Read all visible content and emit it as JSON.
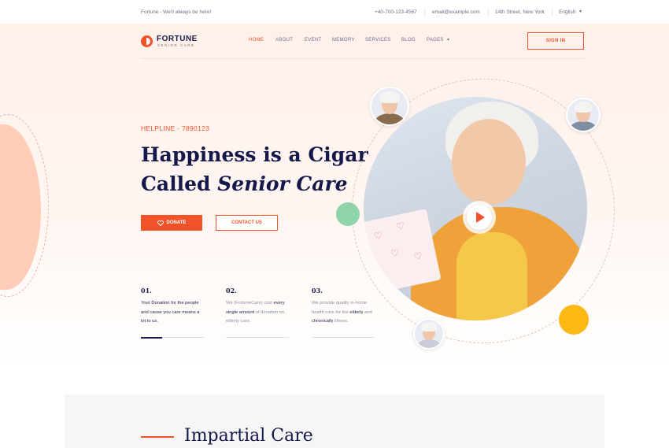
{
  "topbar": {
    "tagline": "Fortune - We'll always be here!",
    "phone": "+40-700-123-4567",
    "email": "email@example.com",
    "address": "14th Street, New York",
    "language": "English"
  },
  "brand": {
    "name": "FORTUNE",
    "subtitle": "SENIOR CARE",
    "accent": "#f0522a"
  },
  "nav": {
    "items": [
      {
        "label": "HOME",
        "active": true
      },
      {
        "label": "ABOUT"
      },
      {
        "label": "EVENT"
      },
      {
        "label": "MEMORY"
      },
      {
        "label": "SERVICES"
      },
      {
        "label": "BLOG"
      },
      {
        "label": "PAGES"
      }
    ],
    "signin_label": "SIGN IN"
  },
  "hero": {
    "helpline": "HELPLINE - 7890123",
    "headline_line1": "Happiness is a Cigar",
    "headline_line2_pre": "Called ",
    "headline_line2_em": "Senior Care",
    "donate_label": "DONATE",
    "contact_label": "CONTACT US"
  },
  "features": [
    {
      "num": "01.",
      "text": "Your Donation for the people and cause you care means a lot to us."
    },
    {
      "num": "02.",
      "text_a": "We (FortuneCare) cost ",
      "text_b": "every single amount",
      "text_c": " of donation on elderly care."
    },
    {
      "num": "03.",
      "text_a": "We provide quality in-home health care for the ",
      "text_b": "elderly",
      "text_c": " and ",
      "text_d": "chronically",
      "text_e": " illness."
    }
  ],
  "section2": {
    "title": "Impartial Care"
  },
  "colors": {
    "accent": "#f0522a",
    "navy": "#15184a",
    "green_dot": "#8fd3a9",
    "yellow_dot": "#fdb913"
  }
}
